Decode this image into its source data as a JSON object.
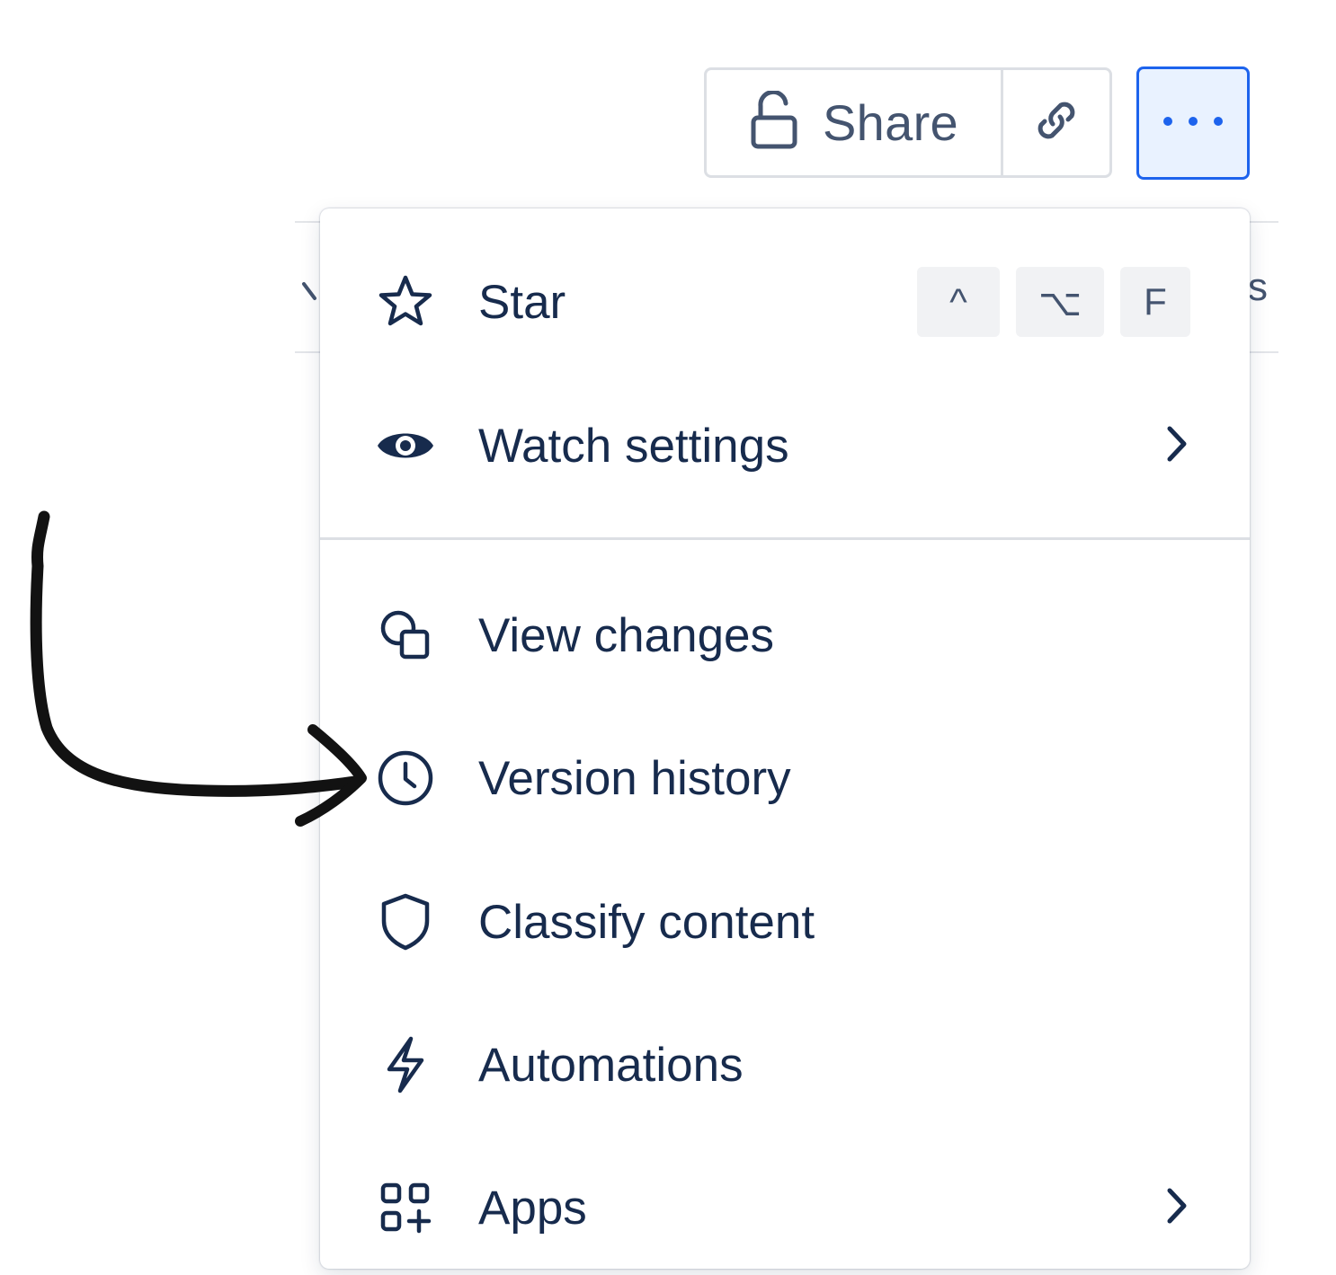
{
  "toolbar": {
    "share_label": "Share",
    "share_icon": "unlock-icon",
    "link_icon": "link-icon",
    "more_icon": "more-horizontal-icon",
    "accent": "#1d63ed"
  },
  "background": {
    "partial_letter": "s"
  },
  "menu": {
    "items": [
      {
        "label": "Star",
        "icon": "star-icon",
        "shortcut": [
          "^",
          "⌥",
          "F"
        ]
      },
      {
        "label": "Watch settings",
        "icon": "eye-icon",
        "submenu": true
      },
      {
        "label": "View changes",
        "icon": "view-changes-icon"
      },
      {
        "label": "Version history",
        "icon": "clock-icon",
        "highlighted_by_annotation": true
      },
      {
        "label": "Classify content",
        "icon": "shield-icon"
      },
      {
        "label": "Automations",
        "icon": "lightning-icon"
      },
      {
        "label": "Apps",
        "icon": "apps-icon",
        "submenu": true
      }
    ]
  },
  "annotation": {
    "type": "hand-drawn-arrow",
    "points_to": "Version history",
    "color": "#111111"
  }
}
